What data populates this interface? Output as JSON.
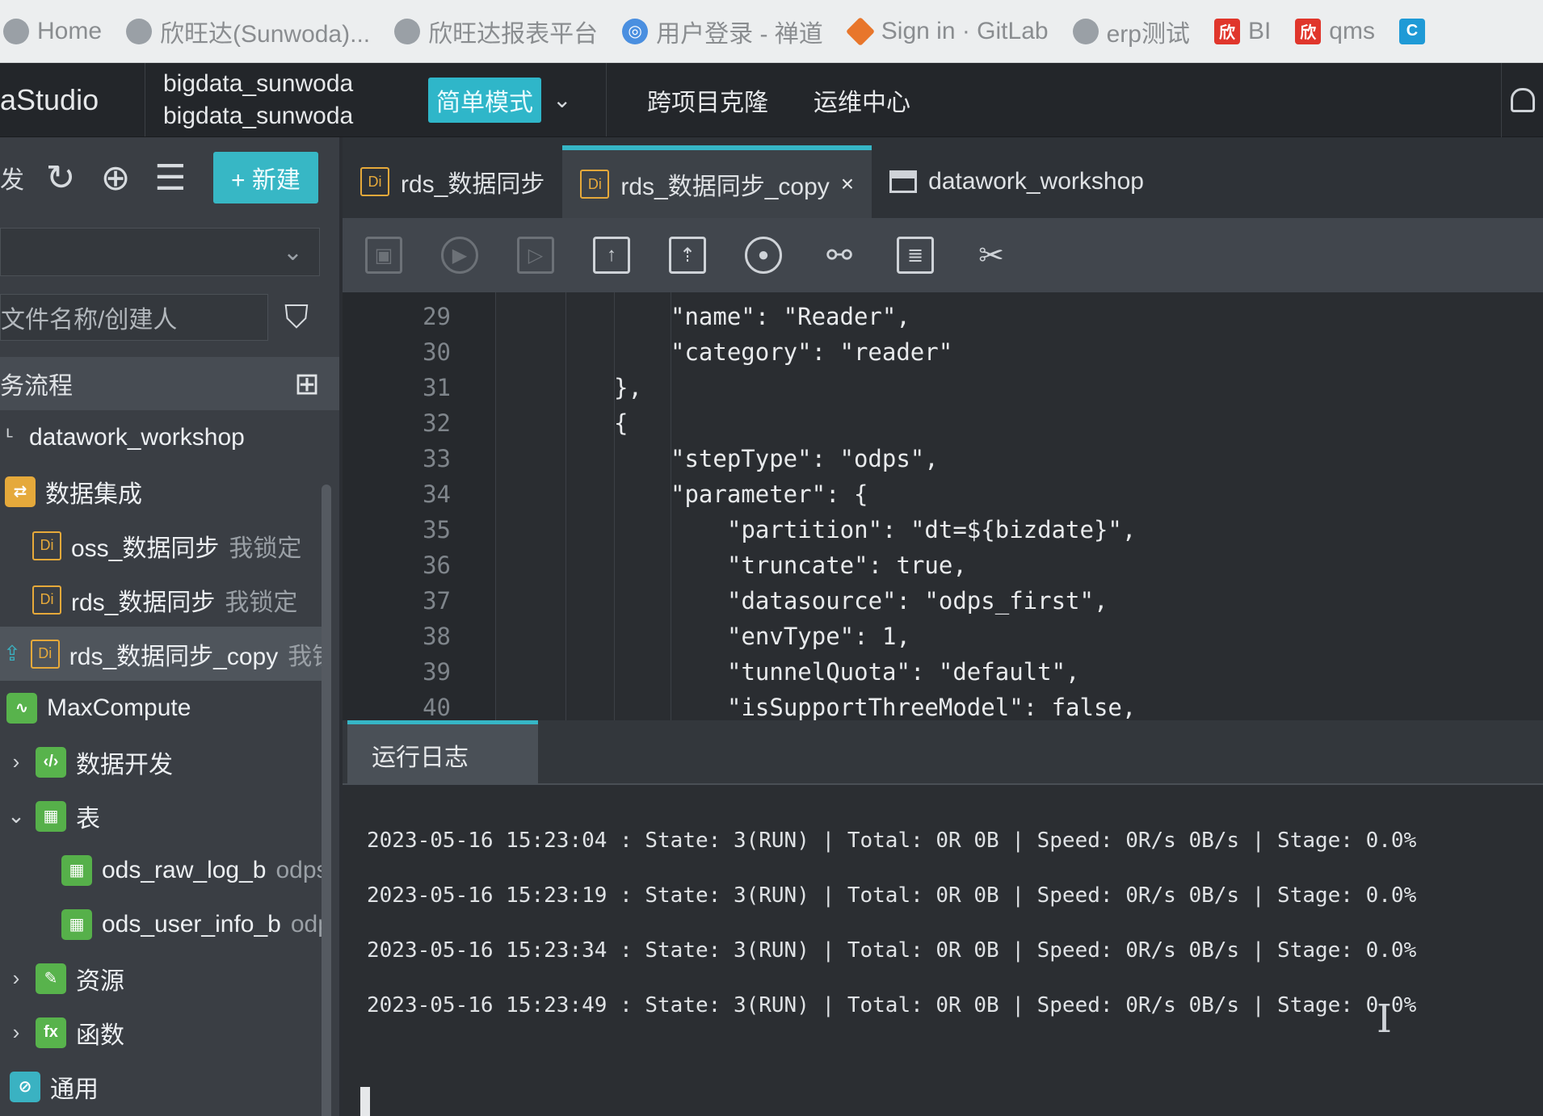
{
  "bookmarks": [
    {
      "label": "Home",
      "icon": "globe-icon"
    },
    {
      "label": "欣旺达(Sunwoda)...",
      "icon": "globe-icon"
    },
    {
      "label": "欣旺达报表平台",
      "icon": "globe-icon"
    },
    {
      "label": "用户登录 - 禅道",
      "icon": "zentao-icon"
    },
    {
      "label": "Sign in · GitLab",
      "icon": "gitlab-icon"
    },
    {
      "label": "erp测试",
      "icon": "globe-icon"
    },
    {
      "label": "BI",
      "icon": "sunwoda-icon"
    },
    {
      "label": "qms",
      "icon": "sunwoda-icon"
    }
  ],
  "header": {
    "app_title": "aStudio",
    "workspace_line1": "bigdata_sunwoda",
    "workspace_line2": "bigdata_sunwoda",
    "mode": "简单模式",
    "nav": [
      "跨项目克隆",
      "运维中心"
    ]
  },
  "sidebar": {
    "toolbar_label": "发",
    "new_button": "+ 新建",
    "search_placeholder": "文件名称/创建人",
    "section_title": "务流程",
    "items": [
      {
        "label": "datawork_workshop",
        "extra": ""
      },
      {
        "label": "数据集成",
        "extra": ""
      },
      {
        "label": "oss_数据同步",
        "extra": "我锁定"
      },
      {
        "label": "rds_数据同步",
        "extra": "我锁定"
      },
      {
        "label": "rds_数据同步_copy",
        "extra": "我锁"
      },
      {
        "label": "MaxCompute",
        "extra": ""
      },
      {
        "label": "数据开发",
        "extra": ""
      },
      {
        "label": "表",
        "extra": ""
      },
      {
        "label": "ods_raw_log_b",
        "extra": "odps"
      },
      {
        "label": "ods_user_info_b",
        "extra": "odp"
      },
      {
        "label": "资源",
        "extra": ""
      },
      {
        "label": "函数",
        "extra": ""
      },
      {
        "label": "通用",
        "extra": ""
      }
    ]
  },
  "tabs": [
    {
      "label": "rds_数据同步",
      "badge": "Di"
    },
    {
      "label": "rds_数据同步_copy",
      "badge": "Di",
      "close": "×"
    },
    {
      "label": "datawork_workshop",
      "badge": ""
    }
  ],
  "editor": {
    "lines": [
      {
        "n": "29",
        "text": "\"name\": \"Reader\","
      },
      {
        "n": "30",
        "text": "\"category\": \"reader\""
      },
      {
        "n": "31",
        "text": "},"
      },
      {
        "n": "32",
        "text": "{"
      },
      {
        "n": "33",
        "text": "\"stepType\": \"odps\","
      },
      {
        "n": "34",
        "text": "\"parameter\": {"
      },
      {
        "n": "35",
        "text": "\"partition\": \"dt=${bizdate}\","
      },
      {
        "n": "36",
        "text": "\"truncate\": true,"
      },
      {
        "n": "37",
        "text": "\"datasource\": \"odps_first\","
      },
      {
        "n": "38",
        "text": "\"envType\": 1,"
      },
      {
        "n": "39",
        "text": "\"tunnelQuota\": \"default\","
      },
      {
        "n": "40",
        "text": "\"isSupportThreeModel\": false,"
      }
    ]
  },
  "log": {
    "tab_label": "运行日志",
    "lines": [
      "2023-05-16 15:23:04 : State: 3(RUN) | Total: 0R 0B | Speed: 0R/s 0B/s | Stage: 0.0%",
      "2023-05-16 15:23:19 : State: 3(RUN) | Total: 0R 0B | Speed: 0R/s 0B/s | Stage: 0.0%",
      "2023-05-16 15:23:34 : State: 3(RUN) | Total: 0R 0B | Speed: 0R/s 0B/s | Stage: 0.0%",
      "2023-05-16 15:23:49 : State: 3(RUN) | Total: 0R 0B | Speed: 0R/s 0B/s | Stage: 0.0%"
    ]
  },
  "colors": {
    "accent": "#36b6c6",
    "di_badge": "#e6a93a"
  }
}
